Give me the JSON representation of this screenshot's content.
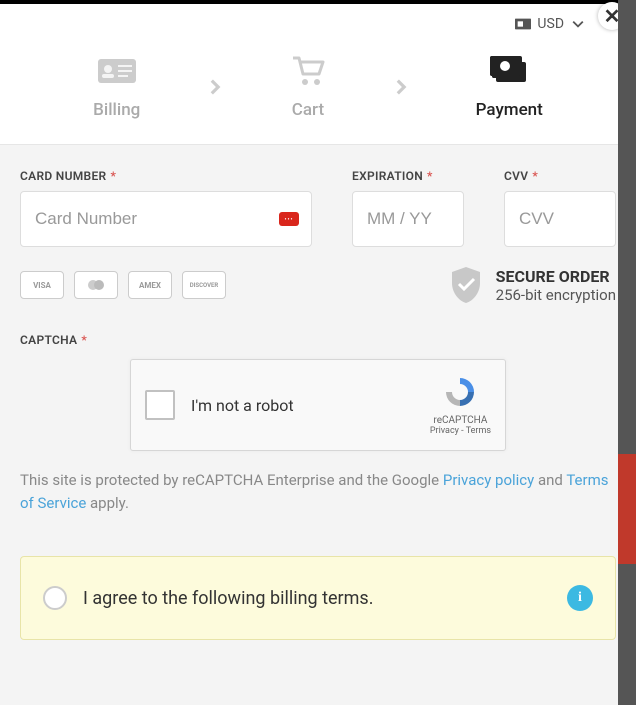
{
  "currency": {
    "code": "USD"
  },
  "steps": {
    "billing": "Billing",
    "cart": "Cart",
    "payment": "Payment"
  },
  "fields": {
    "card_number": {
      "label": "CARD NUMBER",
      "placeholder": "Card Number"
    },
    "expiration": {
      "label": "EXPIRATION",
      "placeholder": "MM / YY"
    },
    "cvv": {
      "label": "CVV",
      "placeholder": "CVV"
    },
    "captcha": {
      "label": "CAPTCHA"
    }
  },
  "card_brands": [
    "VISA",
    "MC",
    "AMEX",
    "DISCOVER"
  ],
  "secure": {
    "title": "SECURE ORDER",
    "subtitle": "256-bit encryption"
  },
  "recaptcha": {
    "label": "I'm not a robot",
    "brand": "reCAPTCHA",
    "privacy": "Privacy",
    "terms": "Terms"
  },
  "legal": {
    "prefix": "This site is protected by reCAPTCHA Enterprise and the Google ",
    "privacy": "Privacy policy",
    "mid": " and ",
    "terms": "Terms of Service",
    "suffix": " apply."
  },
  "agree": {
    "text": "I agree to the following billing terms."
  }
}
